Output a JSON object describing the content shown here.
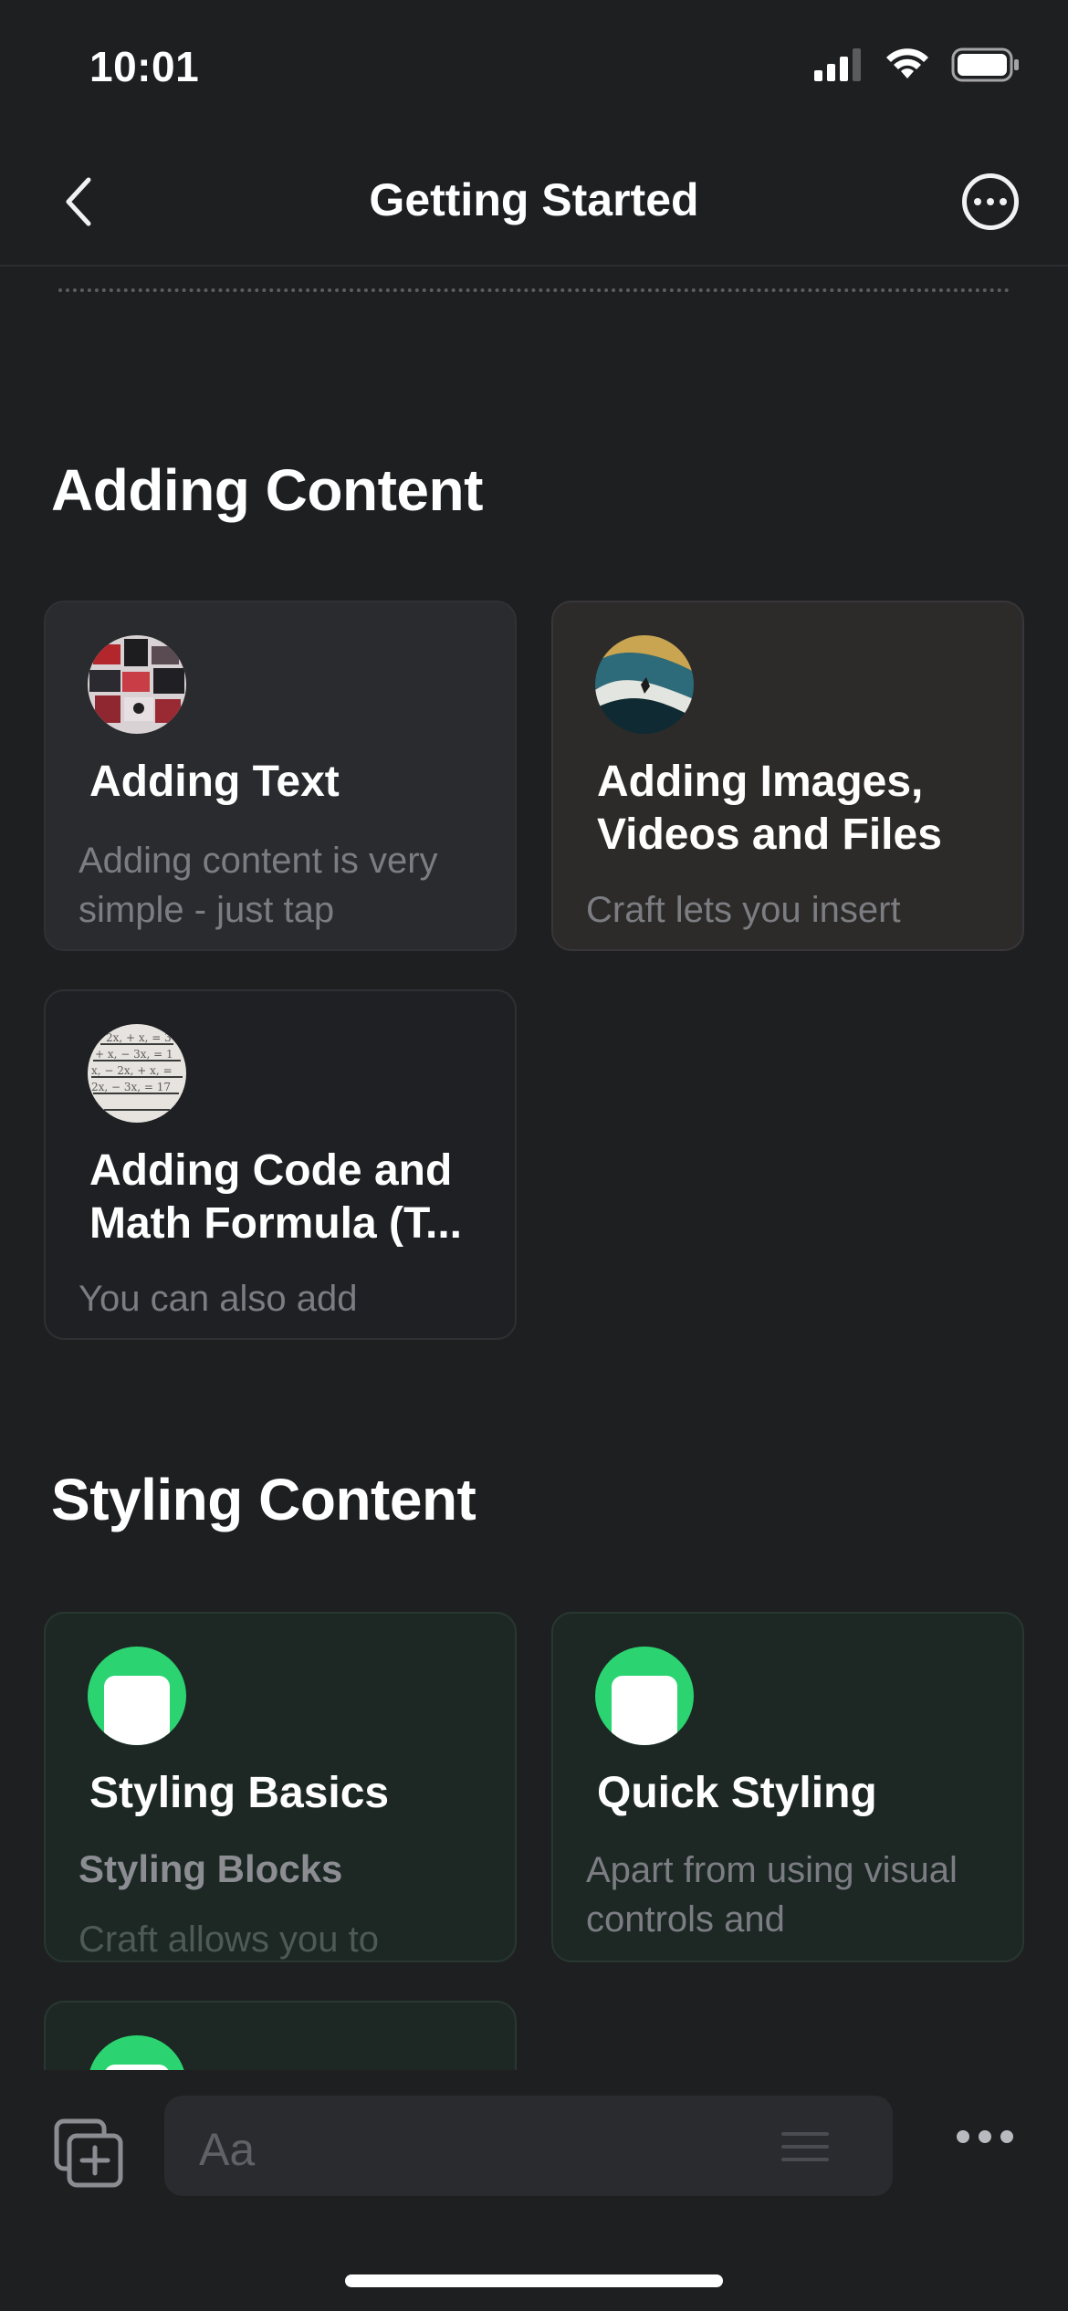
{
  "status": {
    "time": "10:01"
  },
  "nav": {
    "title": "Getting Started"
  },
  "sections": {
    "adding": {
      "title": "Adding Content"
    },
    "styling": {
      "title": "Styling Content"
    }
  },
  "cards": {
    "adding_text": {
      "title": "Adding Text",
      "text": "Adding content is very simple - just tap"
    },
    "adding_images": {
      "title": "Adding Images, Videos and Files",
      "text": "Craft lets you insert"
    },
    "adding_code": {
      "title": "Adding Code and Math Formula (T...",
      "text": "You can also add"
    },
    "styling_basics": {
      "title": "Styling Basics",
      "subtitle": "Styling Blocks",
      "text": "Craft allows you to"
    },
    "quick_styling": {
      "title": "Quick Styling",
      "text": "Apart from using visual controls and"
    }
  },
  "toolbar": {
    "input_placeholder": "Aa"
  },
  "icons": [
    "chevron-left-icon",
    "more-circle-icon",
    "add-page-icon",
    "ellipsis-icon",
    "cellular-icon",
    "wifi-icon",
    "battery-icon"
  ],
  "colors": {
    "background": "#1e1f21",
    "accent_green": "#2bd470"
  }
}
